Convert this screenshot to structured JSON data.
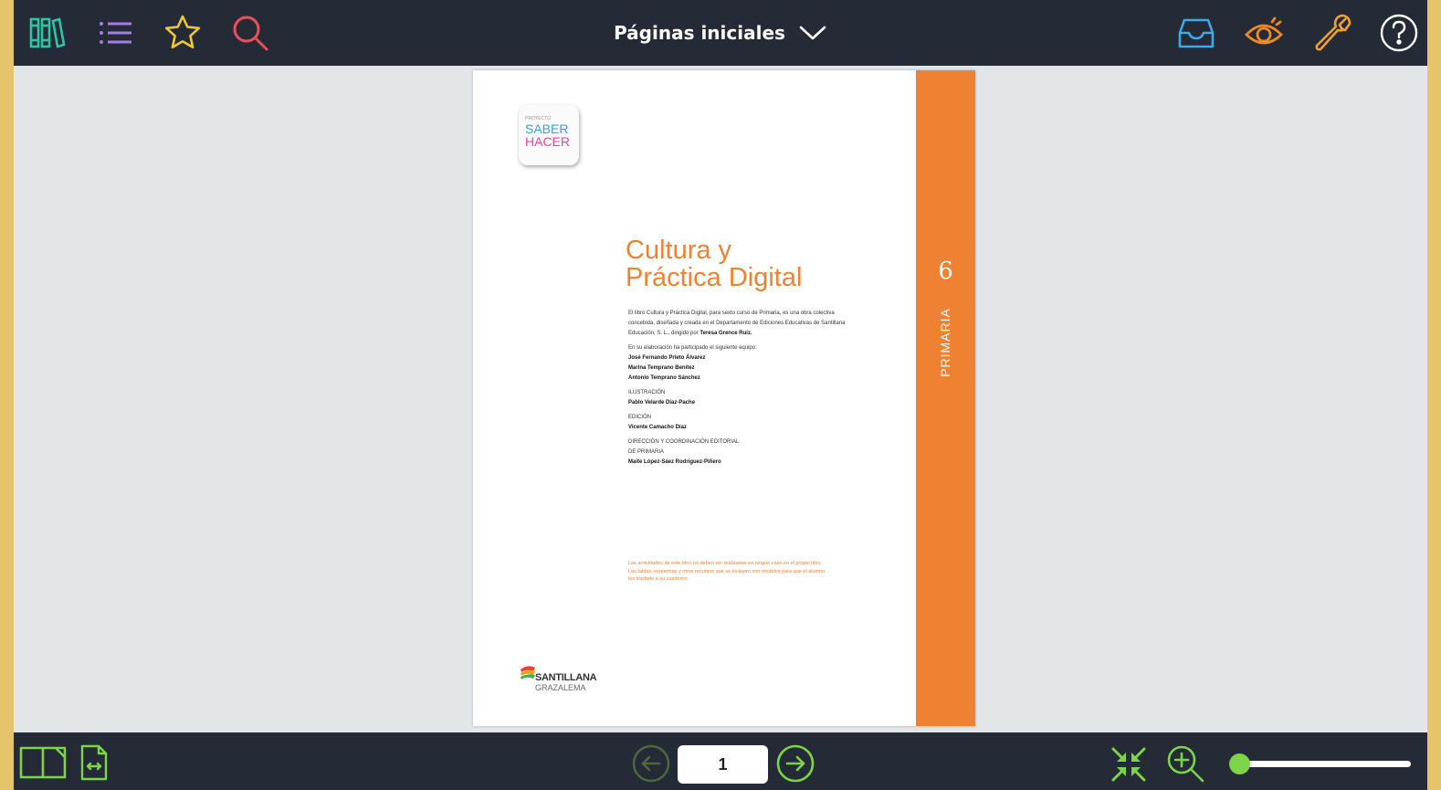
{
  "header": {
    "section_title": "Páginas iniciales",
    "icons": {
      "library": "library-icon",
      "index": "list-icon",
      "favorites": "star-icon",
      "search": "search-icon",
      "inbox": "inbox-icon",
      "view": "eye-icon",
      "tools": "wrench-icon",
      "help": "help-icon"
    }
  },
  "colors": {
    "toolbar_bg": "#252b36",
    "library_icon": "#2ec4a6",
    "list_icon": "#a57be8",
    "star_icon": "#f0c830",
    "search_icon": "#e8505a",
    "inbox_icon": "#3fa9e8",
    "eye_icon": "#f08a24",
    "wrench_icon": "#f0a030",
    "help_icon": "#ffffff",
    "bottom_icons": "#7cd448",
    "book_accent": "#ee8232"
  },
  "page": {
    "logo": {
      "small": "PROYECTO",
      "line1": "SABER",
      "line2": "HACER"
    },
    "title_line1": "Cultura y",
    "title_line2": "Práctica Digital",
    "band_number": "6",
    "band_label": "PRIMARIA",
    "intro": "El libro Cultura y Práctica Digital, para sexto curso de Primaria, es una obra colectiva concebida, diseñada y creada en el Departamento de Ediciones Educativas de Santillana Educación, S. L., dirigido por",
    "director": "Teresa Grence Ruiz.",
    "team_intro": "En su elaboración ha participado el siguiente equipo:",
    "team": [
      "José Fernando Prieto Álvarez",
      "Marina Temprano Benítez",
      "Antonio Temprano Sánchez"
    ],
    "illustration_label": "ILUSTRACIÓN",
    "illustrator": "Pablo Velarde Díaz-Pache",
    "edition_label": "EDICIÓN",
    "editor": "Vicente Camacho Díaz",
    "direction_label_1": "DIRECCIÓN Y COORDINACIÓN EDITORIAL",
    "direction_label_2": "DE PRIMARIA",
    "director_editorial": "Maite López-Sáez Rodríguez-Piñero",
    "notice": "Las actividades de este libro no deben ser realizadas en ningún caso en el propio libro. Las tablas, esquemas y otros recursos que se incluyen son modelos para que el alumno los traslade a su cuaderno.",
    "publisher_name": "SANTILLANA",
    "publisher_sub": "GRAZALEMA"
  },
  "footer": {
    "page_number": "1",
    "zoom_level": 0.0,
    "icons": {
      "single_page": "book-open-icon",
      "fit_width": "fit-width-icon",
      "prev": "arrow-left-circle-icon",
      "next": "arrow-right-circle-icon",
      "collapse": "collapse-icon",
      "zoom_in": "zoom-in-icon"
    }
  }
}
